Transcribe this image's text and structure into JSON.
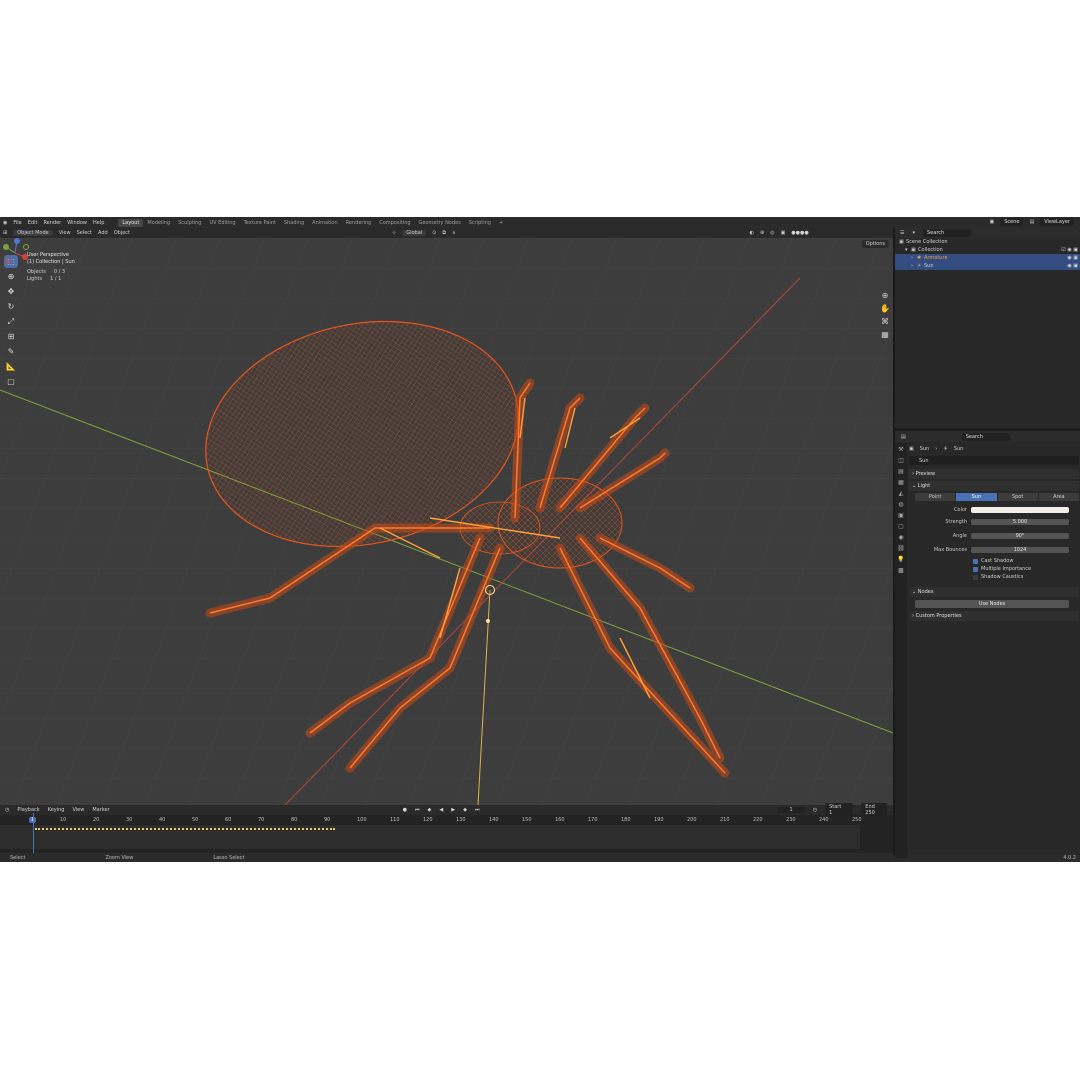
{
  "topbar": {
    "menu": [
      "File",
      "Edit",
      "Render",
      "Window",
      "Help"
    ],
    "workspaces": [
      "Layout",
      "Modeling",
      "Sculpting",
      "UV Editing",
      "Texture Paint",
      "Shading",
      "Animation",
      "Rendering",
      "Compositing",
      "Geometry Nodes",
      "Scripting"
    ],
    "active_workspace": "Layout",
    "scene": "Scene",
    "view_layer": "ViewLayer"
  },
  "viewport_header": {
    "mode": "Object Mode",
    "menus": [
      "View",
      "Select",
      "Add",
      "Object"
    ],
    "transform": "Global",
    "options": "Options"
  },
  "viewport": {
    "title": "User Perspective",
    "collection": "(1) Collection | Sun",
    "objects_label": "Objects",
    "objects_value": "0 / 3",
    "lights_label": "Lights",
    "lights_value": "1 / 1"
  },
  "timeline": {
    "menus": [
      "Playback",
      "Keying",
      "View",
      "Marker"
    ],
    "current_frame": "1",
    "start_label": "Start",
    "start": "1",
    "end_label": "End",
    "end": "250",
    "ticks": [
      "1",
      "10",
      "20",
      "30",
      "40",
      "50",
      "60",
      "70",
      "80",
      "90",
      "100",
      "110",
      "120",
      "130",
      "140",
      "150",
      "160",
      "170",
      "180",
      "190",
      "200",
      "210",
      "220",
      "230",
      "240",
      "250"
    ]
  },
  "statusbar": {
    "select": "Select",
    "zoom": "Zoom View",
    "lasso": "Lasso Select",
    "version": "4.0.2"
  },
  "outliner": {
    "search_placeholder": "Search",
    "items": [
      {
        "label": "Scene Collection"
      },
      {
        "label": "Collection"
      },
      {
        "label": "Armature"
      },
      {
        "label": "Sun"
      }
    ]
  },
  "properties": {
    "search_placeholder": "Search",
    "breadcrumb_object": "Sun",
    "breadcrumb_data": "Sun",
    "name": "Sun",
    "preview": "Preview",
    "light": "Light",
    "light_types": [
      "Point",
      "Sun",
      "Spot",
      "Area"
    ],
    "active_type": "Sun",
    "color_label": "Color",
    "color_value": "#f2ede6",
    "strength_label": "Strength",
    "strength": "5.000",
    "angle_label": "Angle",
    "angle": "90°",
    "bounces_label": "Max Bounces",
    "bounces": "1024",
    "cast_shadow": "Cast Shadow",
    "multiple_importance": "Multiple Importance",
    "shadow_caustics": "Shadow Caustics",
    "nodes": "Nodes",
    "use_nodes": "Use Nodes",
    "custom_properties": "Custom Properties"
  },
  "colors": {
    "accent": "#4772b3",
    "wire": "#e8551c",
    "bone": "#ff8a2a",
    "x_axis": "#b3483a",
    "y_axis": "#7fa33a"
  }
}
